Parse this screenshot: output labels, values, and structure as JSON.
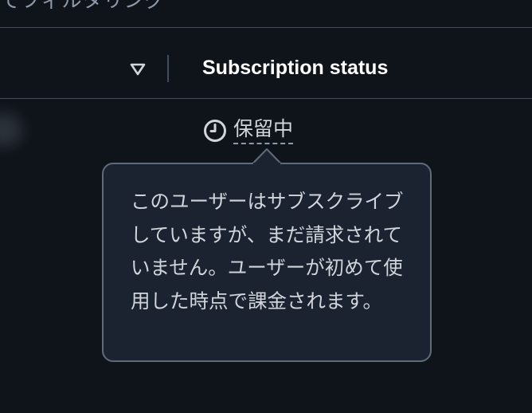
{
  "filter": {
    "text": "でフィルタリング"
  },
  "table": {
    "column_header": "Subscription status",
    "sort_icon": "sort-descending-icon",
    "row": {
      "status_icon": "clock-icon",
      "status_label": "保留中"
    }
  },
  "popover": {
    "text": "このユーザーはサブスクライブしていますが、まだ請求されていません。ユーザーが初めて使用した時点で課金されます。"
  },
  "colors": {
    "background": "#0f141a",
    "divider": "#414d5c",
    "popover_background": "#1b2330",
    "popover_border": "#5f6b7a",
    "text": "#d1d5db",
    "header_text": "#ffffff"
  }
}
